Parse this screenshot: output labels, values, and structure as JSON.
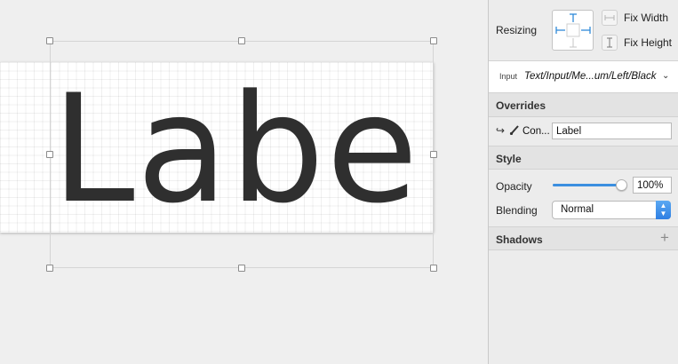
{
  "canvas": {
    "label_text": "Label"
  },
  "inspector": {
    "resizing": {
      "label": "Resizing",
      "fix_width_label": "Fix Width",
      "fix_height_label": "Fix Height"
    },
    "symbol": {
      "small_label": "Input",
      "name": "Text/Input/Me...um/Left/Black",
      "chevron": "⌄"
    },
    "overrides": {
      "title": "Overrides",
      "arrow_icon": "↪",
      "brush_icon": "🖌",
      "label": "Con...",
      "value": "Label"
    },
    "style": {
      "title": "Style",
      "opacity_label": "Opacity",
      "opacity_value": "100%",
      "opacity_level": 1.0,
      "blending_label": "Blending",
      "blending_value": "Normal",
      "stepper_up": "▲",
      "stepper_down": "▼"
    },
    "shadows": {
      "title": "Shadows",
      "add_icon": "+"
    }
  },
  "colors": {
    "accent": "#3b8fe0",
    "text_fill": "#2f2f2f"
  }
}
